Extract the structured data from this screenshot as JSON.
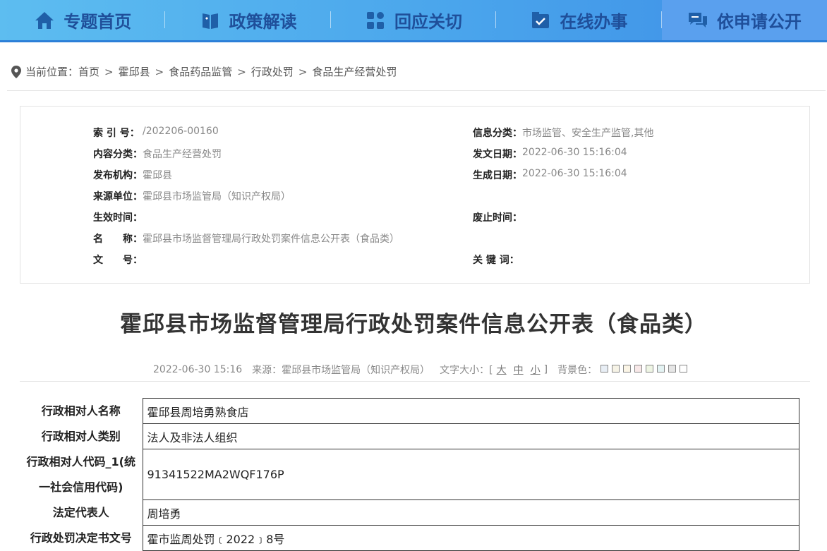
{
  "nav": {
    "items": [
      {
        "label": "专题首页",
        "icon": "home-icon"
      },
      {
        "label": "政策解读",
        "icon": "book-icon"
      },
      {
        "label": "回应关切",
        "icon": "grid-icon"
      },
      {
        "label": "在线办事",
        "icon": "briefcase-icon"
      },
      {
        "label": "依申请公开",
        "icon": "chat-icon"
      }
    ]
  },
  "breadcrumb": {
    "prefix": "当前位置：",
    "items": [
      "首页",
      "霍邱县",
      "食品药品监管",
      "行政处罚",
      "食品生产经营处罚"
    ],
    "sep": ">"
  },
  "meta": {
    "index_label": "索 引 号：",
    "index_value": "/202206-00160",
    "category_label": "信息分类：",
    "category_value": "市场监管、安全生产监管,其他",
    "content_label": "内容分类：",
    "content_value": "食品生产经营处罚",
    "issue_date_label": "发文日期：",
    "issue_date_value": "2022-06-30 15:16:04",
    "org_label": "发布机构：",
    "org_value": "霍邱县",
    "gen_date_label": "生成日期：",
    "gen_date_value": "2022-06-30 15:16:04",
    "source_label": "来源单位：",
    "source_value": "霍邱县市场监管局（知识产权局）",
    "effective_label": "生效时间：",
    "effective_value": "",
    "expire_label": "废止时间：",
    "expire_value": "",
    "name_label": "名　　称：",
    "name_value": "霍邱县市场监督管理局行政处罚案件信息公开表（食品类）",
    "docno_label": "文　　号：",
    "docno_value": "",
    "keywords_label": "关 键 词：",
    "keywords_value": ""
  },
  "title": "霍邱县市场监督管理局行政处罚案件信息公开表（食品类）",
  "info": {
    "datetime": "2022-06-30 15:16",
    "source": "来源：霍邱县市场监管局（知识产权局）",
    "font_size_label": "文字大小：[",
    "font_large": "大",
    "font_medium": "中",
    "font_small": "小",
    "font_close": "]",
    "bg_label": "背景色：",
    "bg_colors": [
      "#e8eef5",
      "#f6f3e6",
      "#fbf5e6",
      "#f8e8e8",
      "#eef5e4",
      "#e4f3f3",
      "#e6e6e6",
      "#ffffff"
    ]
  },
  "table": {
    "rows": [
      {
        "key": "行政相对人名称",
        "value": "霍邱县周培勇熟食店"
      },
      {
        "key": "行政相对人类别",
        "value": "法人及非法人组织"
      },
      {
        "key": "行政相对人代码_1(统一社会信用代码)",
        "value": "91341522MA2WQF176P"
      },
      {
        "key": "法定代表人",
        "value": "周培勇"
      },
      {
        "key": "行政处罚决定书文号",
        "value": "霍市监周处罚﹝2022﹞8号"
      }
    ]
  }
}
